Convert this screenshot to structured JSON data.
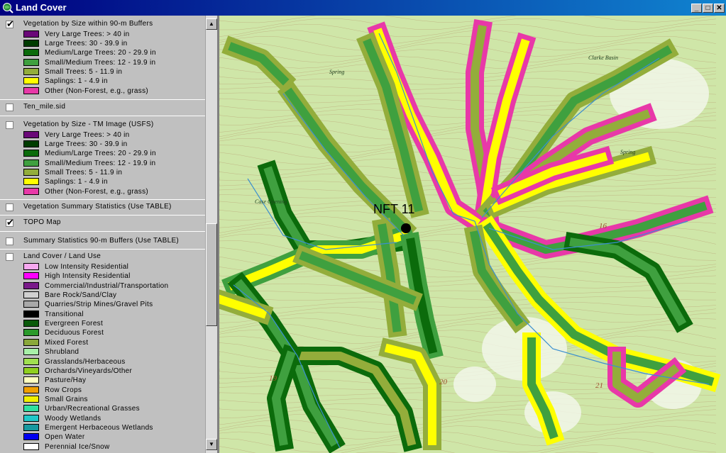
{
  "window": {
    "title": "Land Cover"
  },
  "title_buttons": {
    "min": "_",
    "max": "□",
    "close": "✕"
  },
  "colors": {
    "titlebar": "#000080",
    "map_bg": "#cfe6a8",
    "stream": "#3a8fd0",
    "contour": "#b5926a"
  },
  "legend": {
    "veg90": {
      "title": "Vegetation by Size within 90-m Buffers",
      "checked": true,
      "classes": [
        {
          "label": "Very Large Trees: > 40  in",
          "color": "#6a0878"
        },
        {
          "label": "Large Trees: 30 - 39.9 in",
          "color": "#003c00"
        },
        {
          "label": "Medium/Large Trees: 20 - 29.9 in",
          "color": "#0b6b0b"
        },
        {
          "label": "Small/Medium Trees: 12 - 19.9 in",
          "color": "#3fa03f"
        },
        {
          "label": "Small Trees: 5 - 11.9 in",
          "color": "#93ad3b"
        },
        {
          "label": "Saplings: 1 - 4.9 in",
          "color": "#ffff00"
        },
        {
          "label": "Other (Non-Forest, e.g., grass)",
          "color": "#e838a8"
        }
      ]
    },
    "tenmile": {
      "title": "Ten_mile.sid",
      "checked": false
    },
    "vegtm": {
      "title": "Vegetation by Size - TM Image (USFS)",
      "checked": false,
      "classes": [
        {
          "label": "Very Large Trees: > 40  in",
          "color": "#6a0878"
        },
        {
          "label": "Large Trees: 30 - 39.9 in",
          "color": "#003c00"
        },
        {
          "label": "Medium/Large Trees: 20 - 29.9 in",
          "color": "#0b6b0b"
        },
        {
          "label": "Small/Medium Trees: 12 - 19.9 in",
          "color": "#3fa03f"
        },
        {
          "label": "Small Trees: 5 - 11.9 in",
          "color": "#93ad3b"
        },
        {
          "label": "Saplings: 1 - 4.9 in",
          "color": "#ffff00"
        },
        {
          "label": "Other (Non-Forest, e.g., grass)",
          "color": "#e838a8"
        }
      ]
    },
    "vegsum": {
      "title": "Vegetation Summary Statistics (Use TABLE)",
      "checked": false
    },
    "topo": {
      "title": "TOPO Map",
      "checked": true
    },
    "sumstats": {
      "title": "Summary Statistics 90-m Buffers (Use TABLE)",
      "checked": false
    },
    "landcover": {
      "title": "Land Cover / Land Use",
      "checked": false,
      "classes": [
        {
          "label": "Low Intensity Residential",
          "color": "#f7a8f0"
        },
        {
          "label": "High Intensity Residential",
          "color": "#ff00ff"
        },
        {
          "label": "Commercial/Industrial/Transportation",
          "color": "#7a1a8a"
        },
        {
          "label": "Bare Rock/Sand/Clay",
          "color": "#d0d0d0"
        },
        {
          "label": "Quarries/Strip Mines/Gravel Pits",
          "color": "#a8a8a8"
        },
        {
          "label": "Transitional",
          "color": "#000000"
        },
        {
          "label": "Evergreen Forest",
          "color": "#0a5a0a"
        },
        {
          "label": "Deciduous Forest",
          "color": "#2a9a2a"
        },
        {
          "label": "Mixed Forest",
          "color": "#8aa83a"
        },
        {
          "label": "Shrubland",
          "color": "#a8f0a8"
        },
        {
          "label": "Grasslands/Herbaceous",
          "color": "#a0e050"
        },
        {
          "label": "Orchards/Vineyards/Other",
          "color": "#90d020"
        },
        {
          "label": "Pasture/Hay",
          "color": "#ffffc0"
        },
        {
          "label": "Row Crops",
          "color": "#f0a000"
        },
        {
          "label": "Small Grains",
          "color": "#f0f000"
        },
        {
          "label": "Urban/Recreational Grasses",
          "color": "#30e0a0"
        },
        {
          "label": "Woody Wetlands",
          "color": "#20c8c8"
        },
        {
          "label": "Emergent Herbaceous Wetlands",
          "color": "#1898a0"
        },
        {
          "label": "Open Water",
          "color": "#0000f0"
        },
        {
          "label": "Perennial Ice/Snow",
          "color": "#ffffff"
        }
      ]
    }
  },
  "map": {
    "site_label": "NFT 11",
    "labels": [
      "Spring",
      "Clarke Basin",
      "Spring",
      "Case Opening",
      "16",
      "20",
      "21",
      "19"
    ]
  }
}
